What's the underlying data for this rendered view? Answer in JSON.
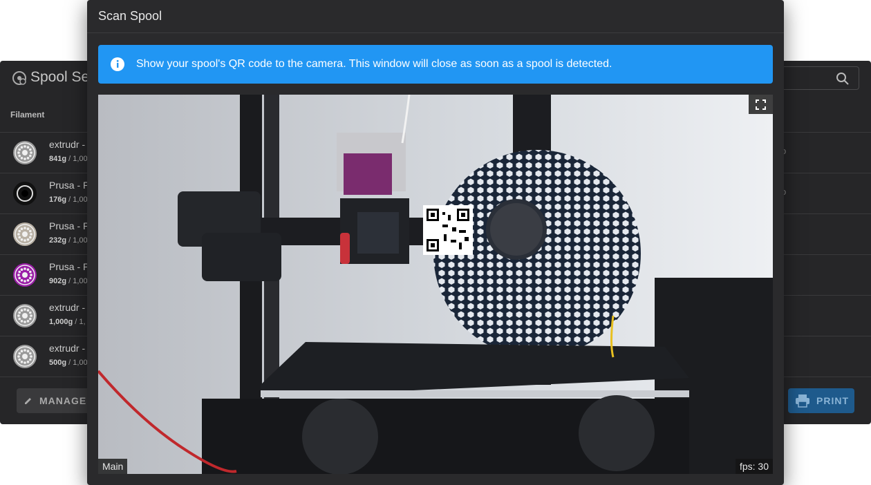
{
  "background": {
    "title": "Spool Sel",
    "column_header": "Filament",
    "rows": [
      {
        "name": "extrudr -",
        "weight": "841g",
        "total": " / 1,00",
        "right": "o",
        "color": "#9a9a9a",
        "icon": "honeycomb-spool"
      },
      {
        "name": "Prusa - P",
        "weight": "176g",
        "total": " / 1,00",
        "right": "o",
        "color": "#111111",
        "icon": "solid-spool"
      },
      {
        "name": "Prusa - P",
        "weight": "232g",
        "total": " / 1,00",
        "right": "",
        "color": "#b8b0a4",
        "icon": "honeycomb-spool"
      },
      {
        "name": "Prusa - P",
        "weight": "902g",
        "total": " / 1,00",
        "right": "",
        "color": "#9b1fa8",
        "icon": "honeycomb-spool"
      },
      {
        "name": "extrudr -",
        "weight": "1,000g",
        "total": " / 1,",
        "right": "",
        "color": "#9a9a9a",
        "icon": "honeycomb-spool"
      },
      {
        "name": "extrudr -",
        "weight": "500g",
        "total": " / 1,00",
        "right": "",
        "color": "#9a9a9a",
        "icon": "honeycomb-spool"
      }
    ],
    "manage_label": "MANAGE",
    "print_label": "PRINT"
  },
  "modal": {
    "title": "Scan Spool",
    "alert_text": "Show your spool's QR code to the camera. This window will close as soon as a spool is detected.",
    "camera_name": "Main",
    "fps_text": "fps: 30"
  },
  "colors": {
    "alert": "#2196f3",
    "modal_bg": "#2a2a2c",
    "panel_bg": "#262628",
    "print_button": "#1e5a8c"
  }
}
